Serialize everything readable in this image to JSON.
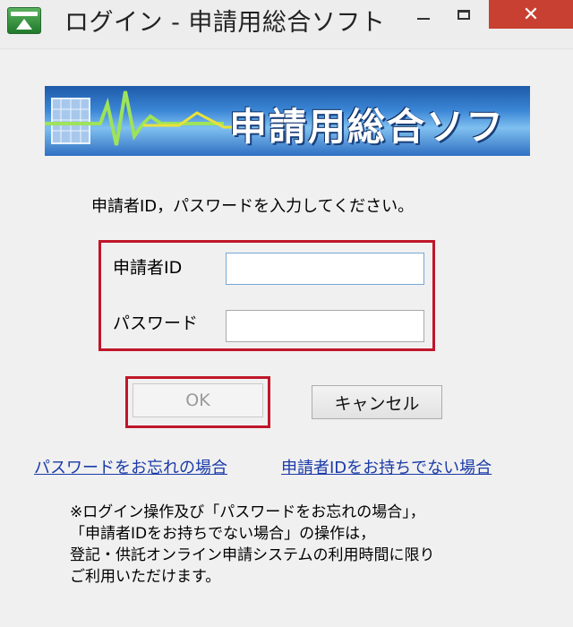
{
  "window": {
    "title": "ログイン - 申請用総合ソフト",
    "close_glyph": "✕"
  },
  "banner": {
    "text": "申請用総合ソフト"
  },
  "form": {
    "instruction": "申請者ID，パスワードを入力してください。",
    "applicant_id_label": "申請者ID",
    "applicant_id_value": "",
    "password_label": "パスワード",
    "password_value": ""
  },
  "buttons": {
    "ok_label": "OK",
    "cancel_label": "キャンセル"
  },
  "links": {
    "forgot_password": "パスワードをお忘れの場合",
    "no_applicant_id": "申請者IDをお持ちでない場合"
  },
  "note": {
    "line1": "※ログイン操作及び「パスワードをお忘れの場合」，",
    "line2": "「申請者IDをお持ちでない場合」の操作は，",
    "line3": "登記・供託オンライン申請システムの利用時間に限り",
    "line4": "ご利用いただけます。"
  },
  "colors": {
    "highlight": "#c0162a",
    "link": "#1a3aa8",
    "close_button": "#c84031"
  }
}
